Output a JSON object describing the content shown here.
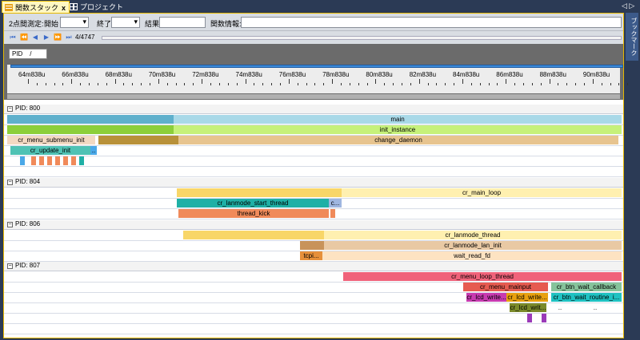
{
  "tabs": [
    {
      "label": "関数スタック",
      "close": "x"
    },
    {
      "label": "プロジェクト"
    }
  ],
  "tab_nav": "◁ ▷",
  "sidebar_label": "ブックマーク",
  "toolbar": {
    "two_point": "2点間測定:",
    "start": "開始",
    "end": "終了",
    "result": "結果",
    "func_info": "関数情報:"
  },
  "position": "4/4747",
  "pid_filter": {
    "label": "PID",
    "value": "/"
  },
  "ticks": [
    "64m838u",
    "66m838u",
    "68m838u",
    "70m838u",
    "72m838u",
    "74m838u",
    "76m838u",
    "78m838u",
    "80m838u",
    "82m838u",
    "84m838u",
    "86m838u",
    "88m838u",
    "90m838u"
  ],
  "groups": [
    {
      "label": "PID: 800"
    },
    {
      "label": "PID: 804"
    },
    {
      "label": "PID: 806"
    },
    {
      "label": "PID: 807"
    }
  ],
  "bars": [
    {
      "label": "main",
      "color": "#a9d9e8"
    },
    {
      "label": "",
      "color": "#5fb0cc"
    },
    {
      "label": "init_instance",
      "color": "#c6f17a"
    },
    {
      "label": "",
      "color": "#8ccf3a"
    },
    {
      "label": "cr_menu_submenu_init",
      "color": "#f3d9c2"
    },
    {
      "label": "change_daemon",
      "color": "#e7c48f"
    },
    {
      "label": "",
      "color": "#b8913a"
    },
    {
      "label": "cr_update_init",
      "color": "#4fc2b4"
    },
    {
      "label": "..",
      "color": "#4aa8e8"
    },
    {
      "label": "cr_main_loop",
      "color": "#fff0b0"
    },
    {
      "label": "",
      "color": "#f8d668"
    },
    {
      "label": "cr_lanmode_start_thread",
      "color": "#1fb0a6"
    },
    {
      "label": "c...",
      "color": "#9fb6e0"
    },
    {
      "label": "thread_kick",
      "color": "#f08a5a"
    },
    {
      "label": "cr_lanmode_thread",
      "color": "#fff0b0"
    },
    {
      "label": "",
      "color": "#f8d668"
    },
    {
      "label": "cr_lanmode_lan_init",
      "color": "#e9c9a4"
    },
    {
      "label": "",
      "color": "#c8935a"
    },
    {
      "label": "tcpi...",
      "color": "#e6903a"
    },
    {
      "label": "wait_read_fd",
      "color": "#fde3c2"
    },
    {
      "label": "cr_menu_loop_thread",
      "color": "#f0627a"
    },
    {
      "label": "cr_menu_mainput",
      "color": "#e65b50"
    },
    {
      "label": "cr_btn_wait_callback",
      "color": "#86c39b"
    },
    {
      "label": "cr_lcd_write...",
      "color": "#c83ab0"
    },
    {
      "label": "cr_lcd_write...",
      "color": "#e8a010"
    },
    {
      "label": "cr_btn_wait_routine_i...",
      "color": "#1fc2c2"
    },
    {
      "label": "cr_lcd_writ...",
      "color": "#7a8a2a"
    },
    {
      "label": "..",
      "color": "#ffffff"
    },
    {
      "label": "..",
      "color": "#ffffff"
    }
  ]
}
